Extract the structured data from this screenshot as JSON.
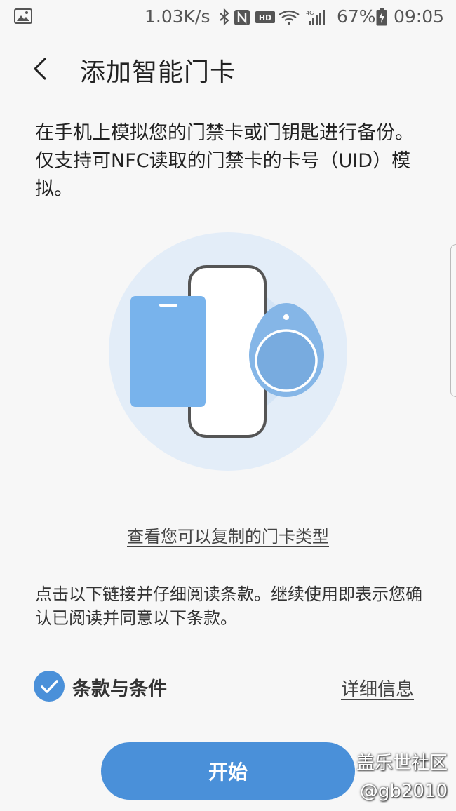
{
  "status_bar": {
    "network_speed": "1.03K/s",
    "network_type": "4G",
    "hd_label": "HD",
    "battery": "67%",
    "time": "09:05",
    "icons": [
      "gallery-icon",
      "bluetooth-icon",
      "nfc-icon",
      "hd-icon",
      "wifi-icon",
      "signal-icon",
      "battery-charging-icon"
    ]
  },
  "header": {
    "title": "添加智能门卡"
  },
  "description": "在手机上模拟您的门禁卡或门钥匙进行备份。仅支持可NFC读取的门禁卡的卡号（UID）模拟。",
  "card_types_link": "查看您可以复制的门卡类型",
  "terms_note": "点击以下链接并仔细阅读条款。继续使用即表示您确认已阅读并同意以下条款。",
  "terms": {
    "label": "条款与条件",
    "checked": true,
    "details_link": "详细信息"
  },
  "start_button": "开始",
  "watermark": {
    "line1": "盖乐世社区",
    "line2": "@gb2010"
  },
  "colors": {
    "accent": "#4a90d9",
    "illustration_bg": "#e3edf8",
    "card": "#78b3ec",
    "fob": "#85b6e7"
  }
}
